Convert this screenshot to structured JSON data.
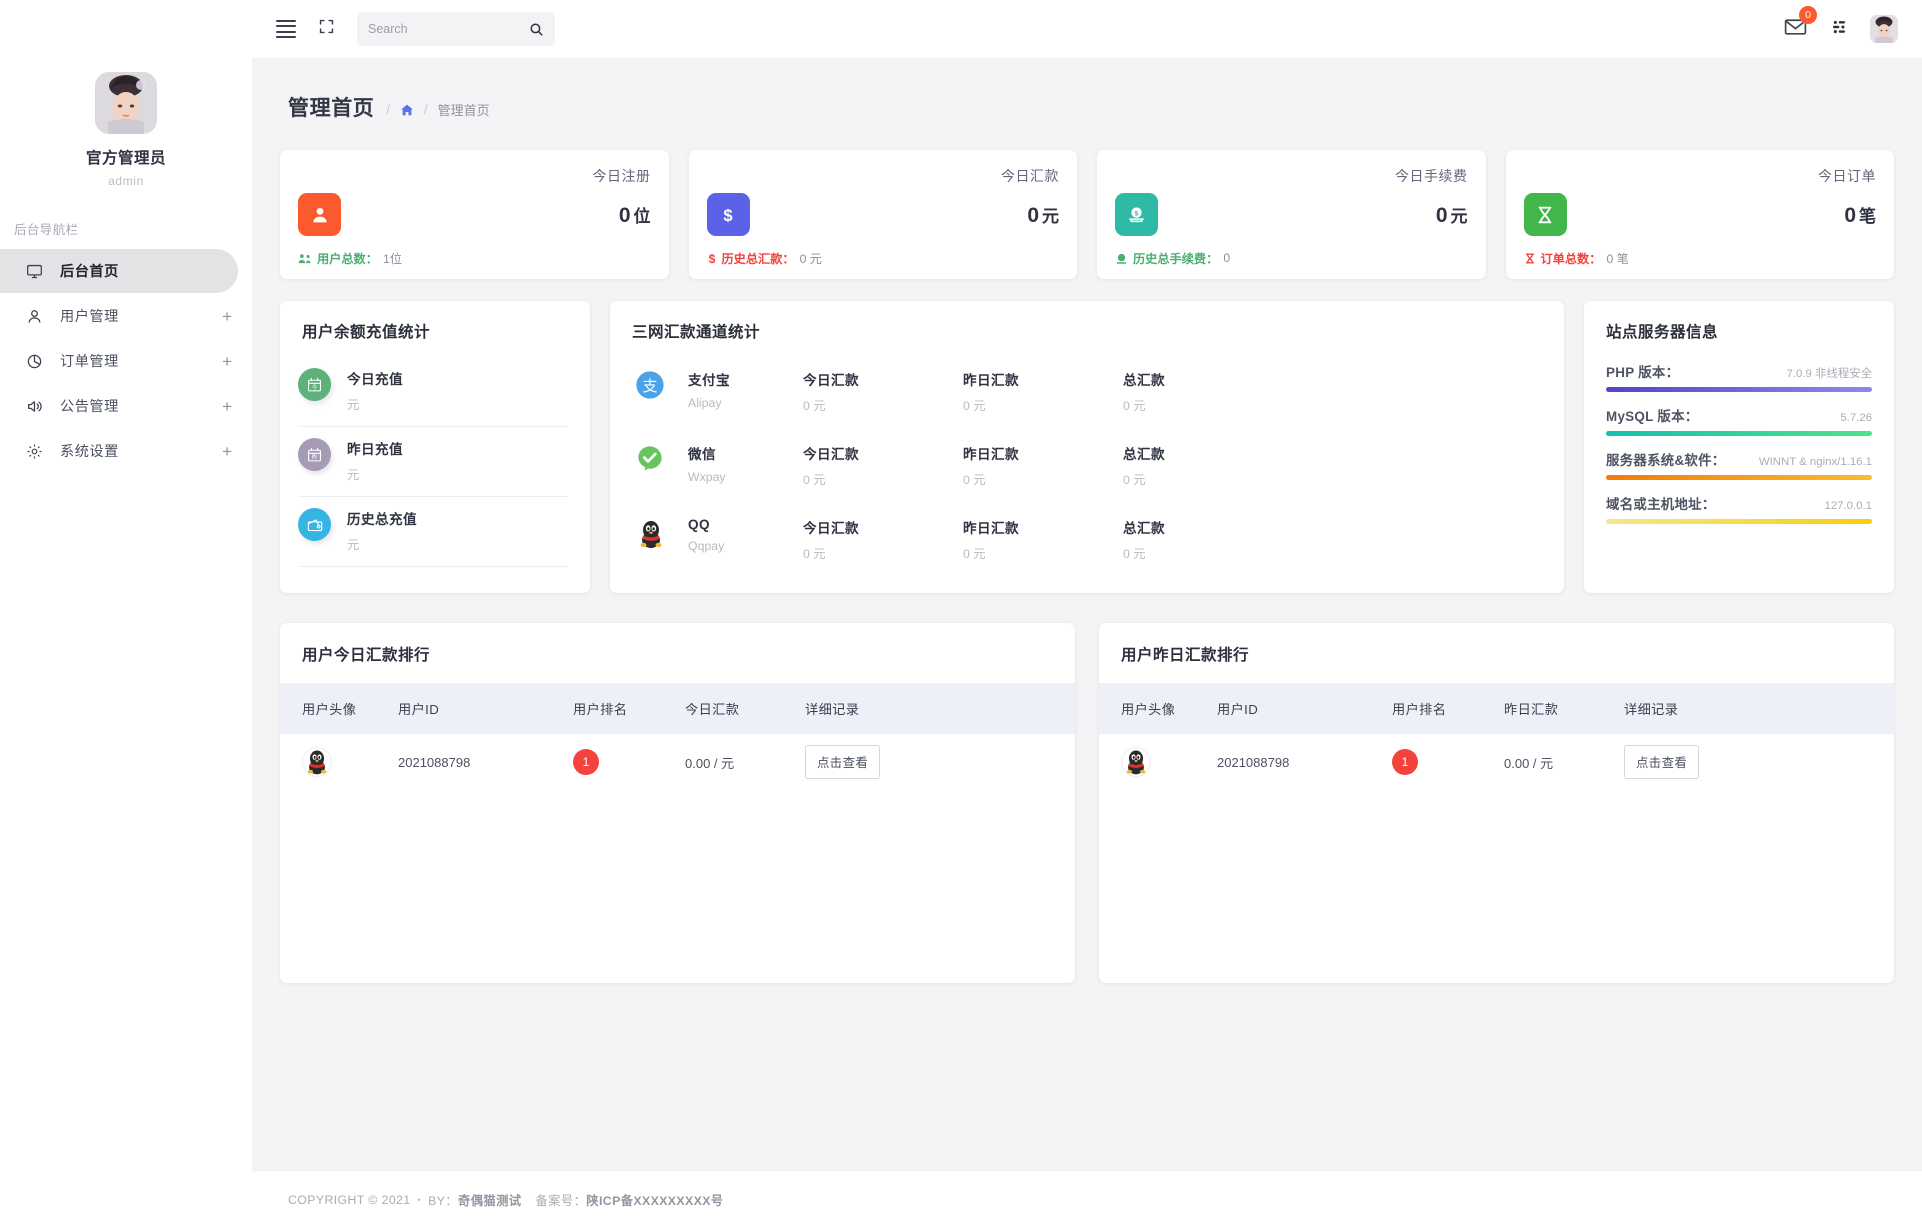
{
  "sidebar": {
    "profile": {
      "name": "官方管理员",
      "role": "admin",
      "avatar_icon": "user-avatar-image"
    },
    "nav_title": "后台导航栏",
    "items": [
      {
        "label": "后台首页",
        "icon": "monitor-icon",
        "active": true,
        "expandable": false
      },
      {
        "label": "用户管理",
        "icon": "user-icon",
        "active": false,
        "expandable": true,
        "plus": "+"
      },
      {
        "label": "订单管理",
        "icon": "pie-chart-icon",
        "active": false,
        "expandable": true,
        "plus": "+"
      },
      {
        "label": "公告管理",
        "icon": "megaphone-icon",
        "active": false,
        "expandable": true,
        "plus": "+"
      },
      {
        "label": "系统设置",
        "icon": "gear-icon",
        "active": false,
        "expandable": true,
        "plus": "+"
      }
    ]
  },
  "topbar": {
    "menu_icon": "hamburger-icon",
    "fullscreen_icon": "expand-icon",
    "search": {
      "value": "",
      "placeholder": "Search",
      "icon": "search-icon"
    },
    "mail": {
      "icon": "envelope-icon",
      "badge": "0",
      "badge_color": "#fa5a2e"
    },
    "apps_icon": "apps-grid-icon",
    "avatar_icon": "user-avatar-image"
  },
  "page": {
    "title": "管理首页",
    "breadcrumb": {
      "sep": "/",
      "home_icon": "home-icon",
      "current": "管理首页"
    }
  },
  "stats": [
    {
      "title": "今日注册",
      "value": "0",
      "unit": "位",
      "icon": "single-user-icon",
      "icon_color": "#fa5a2e",
      "foot_icon": "users-group-icon",
      "foot_label": "用户总数：",
      "foot_value": "1位",
      "foot_color": "#4caf72"
    },
    {
      "title": "今日汇款",
      "value": "0",
      "unit": "元",
      "icon": "dollar-sign-icon",
      "icon_color": "#5b62e8",
      "foot_icon": "dollar-icon",
      "foot_label": "历史总汇款：",
      "foot_value": "0 元",
      "foot_color": "#f4433c"
    },
    {
      "title": "今日手续费",
      "value": "0",
      "unit": "元",
      "icon": "coin-in-slot-icon",
      "icon_color": "#2ebaa5",
      "foot_icon": "coin-icon",
      "foot_label": "历史总手续费：",
      "foot_value": "0",
      "foot_color": "#4caf72"
    },
    {
      "title": "今日订单",
      "value": "0",
      "unit": "笔",
      "icon": "hourglass-icon",
      "icon_color": "#43b649",
      "foot_icon": "hourglass-small-icon",
      "foot_label": "订单总数：",
      "foot_value": "0 笔",
      "foot_color": "#f4433c"
    }
  ],
  "balance_card": {
    "title": "用户余额充值统计",
    "items": [
      {
        "label": "今日充值",
        "unit": "元",
        "icon": "calendar-today-icon",
        "icon_color": "#5eb07c"
      },
      {
        "label": "昨日充值",
        "unit": "元",
        "icon": "calendar-yesterday-icon",
        "icon_color": "#a69bb4"
      },
      {
        "label": "历史总充值",
        "unit": "元",
        "icon": "wallet-icon",
        "icon_color": "#34b5e4"
      }
    ]
  },
  "channel_card": {
    "title": "三网汇款通道统计",
    "columns": [
      "今日汇款",
      "昨日汇款",
      "总汇款"
    ],
    "rows": [
      {
        "name": "支付宝",
        "code": "Alipay",
        "icon": "alipay-icon",
        "today_label": "今日汇款",
        "today": "0 元",
        "yesterday_label": "昨日汇款",
        "yesterday": "0 元",
        "total_label": "总汇款",
        "total": "0 元"
      },
      {
        "name": "微信",
        "code": "Wxpay",
        "icon": "wechat-pay-icon",
        "today_label": "今日汇款",
        "today": "0 元",
        "yesterday_label": "昨日汇款",
        "yesterday": "0 元",
        "total_label": "总汇款",
        "total": "0 元"
      },
      {
        "name": "QQ",
        "code": "Qqpay",
        "icon": "qq-penguin-icon",
        "today_label": "今日汇款",
        "today": "0 元",
        "yesterday_label": "昨日汇款",
        "yesterday": "0 元",
        "total_label": "总汇款",
        "total": "0 元"
      }
    ]
  },
  "server_card": {
    "title": "站点服务器信息",
    "items": [
      {
        "key": "PHP 版本：",
        "value": "7.0.9 非线程安全",
        "bar_from": "#4f46c4",
        "bar_to": "#8f87f0"
      },
      {
        "key": "MySQL 版本：",
        "value": "5.7.26",
        "bar_from": "#16bfb0",
        "bar_to": "#4ee38a"
      },
      {
        "key": "服务器系统&软件：",
        "value": "WINNT & nginx/1.16.1",
        "bar_from": "#f07c0a",
        "bar_to": "#fbbc2e"
      },
      {
        "key": "域名或主机地址：",
        "value": "127.0.0.1",
        "bar_from": "#f2e98a",
        "bar_to": "#f8cf0a"
      }
    ]
  },
  "rank_today": {
    "title": "用户今日汇款排行",
    "columns": [
      "用户头像",
      "用户ID",
      "用户排名",
      "今日汇款",
      "详细记录"
    ],
    "rows": [
      {
        "avatar_icon": "qq-penguin-avatar",
        "user_id": "2021088798",
        "rank": "1",
        "amount": "0.00 / 元",
        "button": "点击查看"
      }
    ]
  },
  "rank_yesterday": {
    "title": "用户昨日汇款排行",
    "columns": [
      "用户头像",
      "用户ID",
      "用户排名",
      "昨日汇款",
      "详细记录"
    ],
    "rows": [
      {
        "avatar_icon": "qq-penguin-avatar",
        "user_id": "2021088798",
        "rank": "1",
        "amount": "0.00 / 元",
        "button": "点击查看"
      }
    ]
  },
  "footer": {
    "copyright": "COPYRIGHT © 2021",
    "dot": "•",
    "by_label": "BY：",
    "by_value": "奇偶猫测试",
    "icp_label": "备案号：",
    "icp_value": "陕ICP备XXXXXXXXX号"
  }
}
